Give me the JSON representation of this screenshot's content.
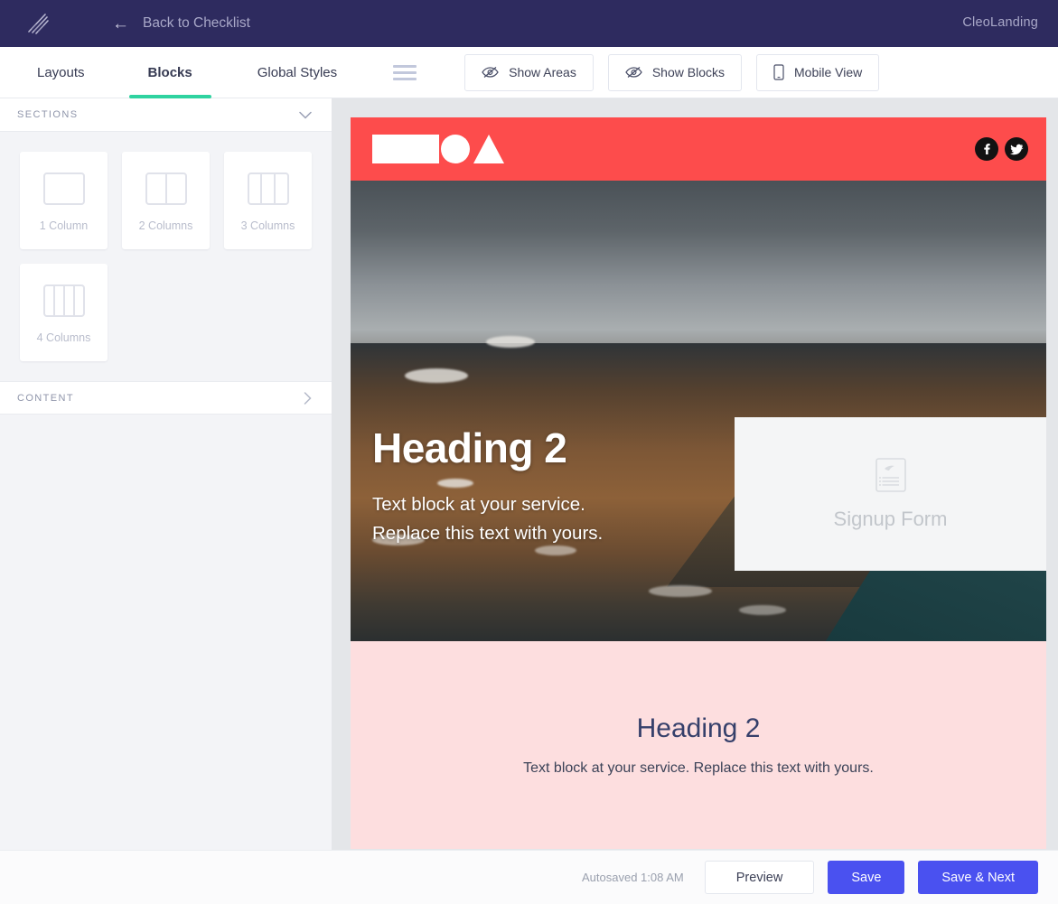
{
  "topbar": {
    "logo_icon": "feather-logo-icon",
    "back_label": "Back to Checklist",
    "back_arrow": "arrow-left-icon",
    "brand_name": "CleoLanding",
    "bg_color": "#2e2b5f",
    "text_color": "#a9a8c8"
  },
  "tabs": [
    {
      "label": "Layouts",
      "active": false
    },
    {
      "label": "Blocks",
      "active": true
    },
    {
      "label": "Global Styles",
      "active": false
    }
  ],
  "tab_accent_color": "#2fd3a0",
  "toolbar": {
    "menu_icon": "hamburger-icon",
    "buttons": [
      {
        "label": "Show Areas",
        "icon": "eye-slash-icon"
      },
      {
        "label": "Show Blocks",
        "icon": "eye-slash-icon"
      },
      {
        "label": "Mobile View",
        "icon": "mobile-phone-icon"
      }
    ]
  },
  "sidebar": {
    "sections": [
      {
        "label": "SECTIONS",
        "expanded": true,
        "chevron": "chevron-down-icon"
      },
      {
        "label": "CONTENT",
        "expanded": false,
        "chevron": "chevron-right-icon"
      }
    ],
    "cards": [
      {
        "label": "1 Column",
        "columns": 1
      },
      {
        "label": "2 Columns",
        "columns": 2
      },
      {
        "label": "3 Columns",
        "columns": 3
      },
      {
        "label": "4 Columns",
        "columns": 4
      }
    ]
  },
  "preview": {
    "canvas_bg": "#e4e6e9",
    "site_header": {
      "bg_color": "#fd4c4c",
      "logo_placeholder": "logo-shapes-placeholder",
      "socials": [
        {
          "name": "facebook-icon",
          "glyph": "f"
        },
        {
          "name": "twitter-icon",
          "glyph": "t"
        }
      ]
    },
    "hero": {
      "heading": "Heading 2",
      "paragraph_line1": "Text block at your service.",
      "paragraph_line2": "Replace this text with yours.",
      "image_alt": "mountain-landscape-photo",
      "signup_form": {
        "label": "Signup Form",
        "icon": "form-document-icon"
      }
    },
    "band": {
      "bg_color": "#fddedf",
      "heading": "Heading 2",
      "paragraph": "Text block at your service. Replace this text with yours.",
      "text_color": "#36406b"
    }
  },
  "footer": {
    "autosaved": "Autosaved 1:08 AM",
    "preview_label": "Preview",
    "save_label": "Save",
    "save_next_label": "Save & Next",
    "primary_color": "#4a51f0"
  }
}
